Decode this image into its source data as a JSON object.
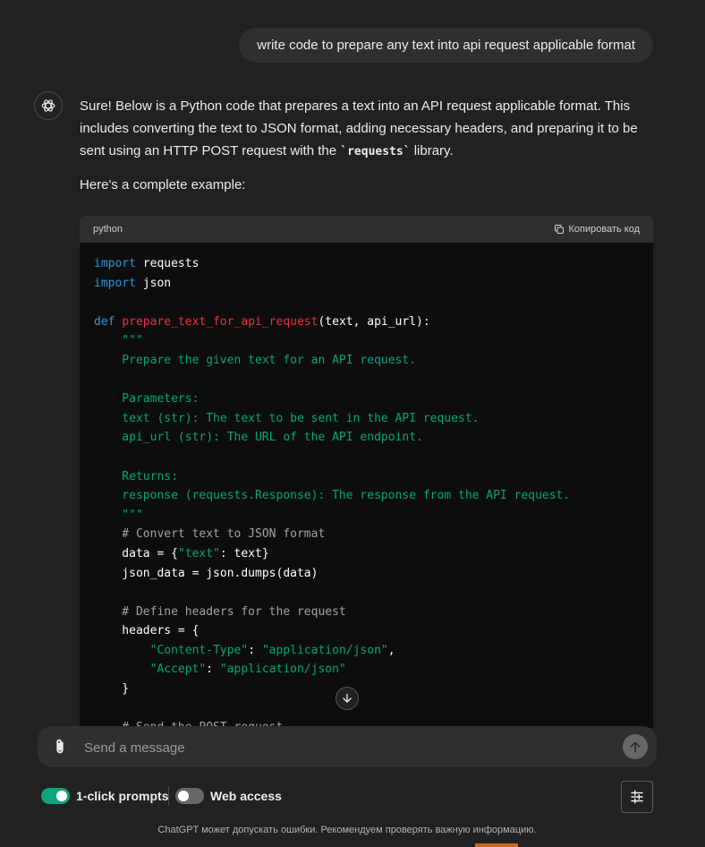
{
  "user_message": "write code to prepare any text into api request applicable format",
  "assistant": {
    "intro_before": "Sure! Below is a Python code that prepares a text into an API request applicable format. This includes converting the text to JSON format, adding necessary headers, and preparing it to be sent using an HTTP POST request with the ",
    "intro_code": "`requests`",
    "intro_after": " library.",
    "example_text": "Here's a complete example:"
  },
  "code_block": {
    "language": "python",
    "copy_label": "Копировать код",
    "lines": [
      [
        {
          "t": "import",
          "c": "kw"
        },
        {
          "t": " requests",
          "c": "plain"
        }
      ],
      [
        {
          "t": "import",
          "c": "kw"
        },
        {
          "t": " json",
          "c": "plain"
        }
      ],
      [],
      [
        {
          "t": "def",
          "c": "kw"
        },
        {
          "t": " ",
          "c": "plain"
        },
        {
          "t": "prepare_text_for_api_request",
          "c": "fn"
        },
        {
          "t": "(text, api_url):",
          "c": "plain"
        }
      ],
      [
        {
          "t": "    \"\"\"",
          "c": "doc"
        }
      ],
      [
        {
          "t": "    Prepare the given text for an API request.",
          "c": "doc"
        }
      ],
      [],
      [
        {
          "t": "    Parameters:",
          "c": "doc"
        }
      ],
      [
        {
          "t": "    text (str): The text to be sent in the API request.",
          "c": "doc"
        }
      ],
      [
        {
          "t": "    api_url (str): The URL of the API endpoint.",
          "c": "doc"
        }
      ],
      [],
      [
        {
          "t": "    Returns:",
          "c": "doc"
        }
      ],
      [
        {
          "t": "    response (requests.Response): The response from the API request.",
          "c": "doc"
        }
      ],
      [
        {
          "t": "    \"\"\"",
          "c": "doc"
        }
      ],
      [
        {
          "t": "    # Convert text to JSON format",
          "c": "com"
        }
      ],
      [
        {
          "t": "    data = {",
          "c": "plain"
        },
        {
          "t": "\"text\"",
          "c": "str"
        },
        {
          "t": ": text}",
          "c": "plain"
        }
      ],
      [
        {
          "t": "    json_data = json.dumps(data)",
          "c": "plain"
        }
      ],
      [],
      [
        {
          "t": "    # Define headers for the request",
          "c": "com"
        }
      ],
      [
        {
          "t": "    headers = {",
          "c": "plain"
        }
      ],
      [
        {
          "t": "        ",
          "c": "plain"
        },
        {
          "t": "\"Content-Type\"",
          "c": "str"
        },
        {
          "t": ": ",
          "c": "plain"
        },
        {
          "t": "\"application/json\"",
          "c": "str"
        },
        {
          "t": ",",
          "c": "plain"
        }
      ],
      [
        {
          "t": "        ",
          "c": "plain"
        },
        {
          "t": "\"Accept\"",
          "c": "str"
        },
        {
          "t": ": ",
          "c": "plain"
        },
        {
          "t": "\"application/json\"",
          "c": "str"
        }
      ],
      [
        {
          "t": "    }",
          "c": "plain"
        }
      ],
      [],
      [
        {
          "t": "    # Send the POST request",
          "c": "com"
        }
      ]
    ]
  },
  "composer": {
    "placeholder": "Send a message"
  },
  "toggles": {
    "one_click_label": "1-click prompts",
    "one_click_on": true,
    "web_access_label": "Web access",
    "web_access_on": false
  },
  "footer_note": "ChatGPT может допускать ошибки. Рекомендуем проверять важную информацию.",
  "colors": {
    "background": "#212121",
    "keyword": "#2e95d3",
    "function": "#f22c3d",
    "string": "#00a67d",
    "comment": "#a3a3a3",
    "toggle_on": "#10a37f",
    "toggle_off": "#676767"
  },
  "icons": {
    "avatar": "openai-logo-icon",
    "copy": "copy-icon",
    "scroll": "arrow-down-icon",
    "attach": "paperclip-icon",
    "send": "arrow-up-icon",
    "settings": "sliders-icon"
  }
}
